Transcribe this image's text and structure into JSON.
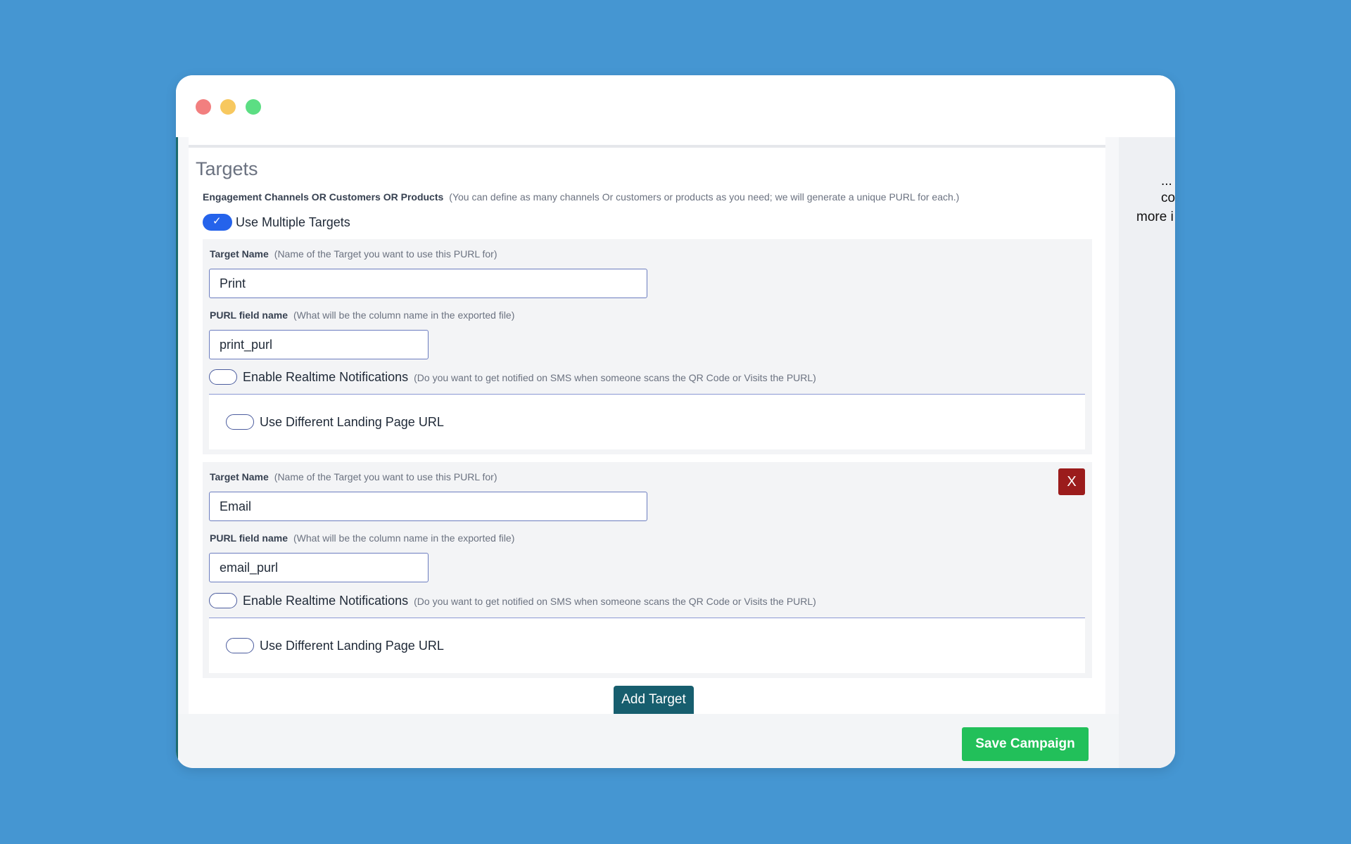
{
  "window": {
    "controls": [
      "close",
      "minimize",
      "maximize"
    ]
  },
  "sidebar_right": {
    "line1": "...",
    "line2": "co",
    "line3": "more i"
  },
  "targets": {
    "heading": "Targets",
    "section_label": "Engagement Channels OR Customers OR Products",
    "section_hint": "(You can define as many channels Or customers or products as you need; we will generate a unique PURL for each.)",
    "multiple_toggle": {
      "label": "Use Multiple Targets",
      "checked": true
    },
    "items": [
      {
        "name_label": "Target Name",
        "name_hint": "(Name of the Target you want to use this PURL for)",
        "name_value": "Print",
        "purl_label": "PURL field name",
        "purl_hint": "(What will be the column name in the exported file)",
        "purl_value": "print_purl",
        "notif_label": "Enable Realtime Notifications",
        "notif_hint": "(Do you want to get notified on SMS when someone scans the QR Code or Visits the PURL)",
        "landing_label": "Use Different Landing Page URL",
        "removable": false
      },
      {
        "name_label": "Target Name",
        "name_hint": "(Name of the Target you want to use this PURL for)",
        "name_value": "Email",
        "purl_label": "PURL field name",
        "purl_hint": "(What will be the column name in the exported file)",
        "purl_value": "email_purl",
        "notif_label": "Enable Realtime Notifications",
        "notif_hint": "(Do you want to get notified on SMS when someone scans the QR Code or Visits the PURL)",
        "landing_label": "Use Different Landing Page URL",
        "removable": true,
        "remove_label": "X"
      }
    ],
    "add_button": "Add Target"
  },
  "footer": {
    "save_button": "Save Campaign"
  },
  "colors": {
    "background": "#4596d2",
    "toggle_on": "#2563eb",
    "remove": "#9b1c1c",
    "add": "#175e6e",
    "save": "#22c05a"
  }
}
